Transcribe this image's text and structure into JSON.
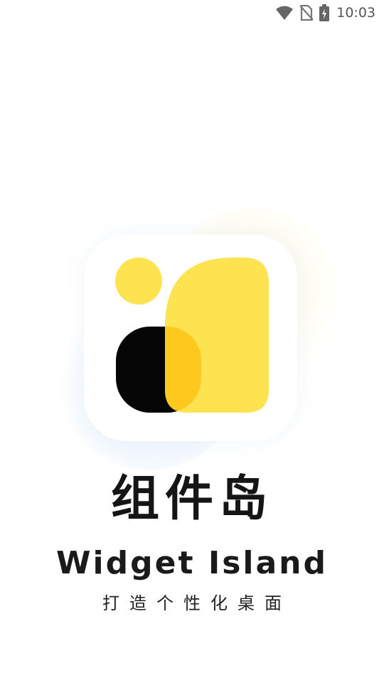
{
  "status_bar": {
    "time": "10:03",
    "icons": [
      "wifi-icon",
      "no-sim-icon",
      "battery-charging-icon"
    ]
  },
  "splash": {
    "title": "组件岛",
    "subtitle": "Widget Island",
    "slogan": "打造个性化桌面"
  },
  "colors": {
    "brand_yellow": "#FEE350",
    "overlap_yellow": "#FFC81E",
    "logo_black": "#050505",
    "text_dark": "#151515",
    "status_gray": "#666666"
  }
}
